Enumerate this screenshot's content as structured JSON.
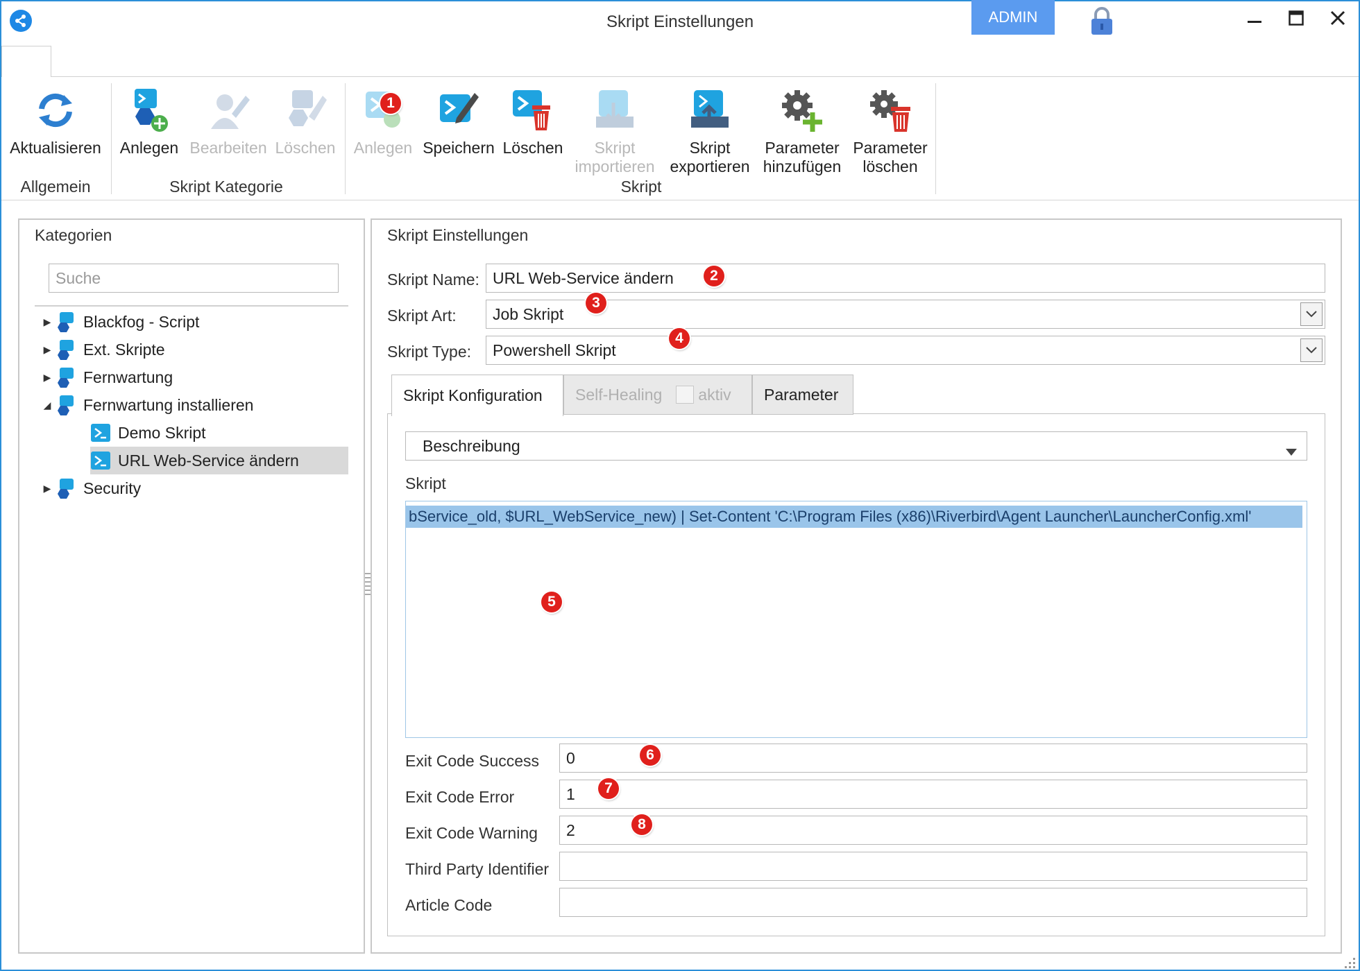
{
  "window": {
    "title": "Skript Einstellungen",
    "admin_label": "ADMIN"
  },
  "ribbon": {
    "groups": [
      {
        "label": "Allgemein"
      },
      {
        "label": "Skript Kategorie"
      },
      {
        "label": "Skript"
      }
    ],
    "buttons": {
      "refresh": "Aktualisieren",
      "cat_create": "Anlegen",
      "cat_edit": "Bearbeiten",
      "cat_delete": "Löschen",
      "script_create": "Anlegen",
      "script_save": "Speichern",
      "script_delete": "Löschen",
      "import_l1": "Skript",
      "import_l2": "importieren",
      "export_l1": "Skript",
      "export_l2": "exportieren",
      "param_add_l1": "Parameter",
      "param_add_l2": "hinzufügen",
      "param_del_l1": "Parameter",
      "param_del_l2": "löschen"
    }
  },
  "categories": {
    "title": "Kategorien",
    "search_placeholder": "Suche",
    "items": [
      {
        "label": "Blackfog - Script"
      },
      {
        "label": "Ext. Skripte"
      },
      {
        "label": "Fernwartung"
      },
      {
        "label": "Fernwartung installieren"
      },
      {
        "label": "Demo Skript"
      },
      {
        "label": "URL Web-Service ändern"
      },
      {
        "label": "Security"
      }
    ]
  },
  "settings": {
    "title": "Skript Einstellungen",
    "name_label": "Skript Name:",
    "name_value": "URL Web-Service ändern",
    "art_label": "Skript Art:",
    "art_value": "Job Skript",
    "type_label": "Skript Type:",
    "type_value": "Powershell Skript",
    "tabs": {
      "config": "Skript Konfiguration",
      "self_healing": "Self-Healing",
      "aktiv": "aktiv",
      "parameter": "Parameter"
    },
    "beschreibung": "Beschreibung",
    "skript_label": "Skript",
    "script_text": "bService_old, $URL_WebService_new) | Set-Content 'C:\\Program Files (x86)\\Riverbird\\Agent Launcher\\LauncherConfig.xml'",
    "exit_success_label": "Exit Code Success",
    "exit_success_value": "0",
    "exit_error_label": "Exit Code Error",
    "exit_error_value": "1",
    "exit_warning_label": "Exit Code Warning",
    "exit_warning_value": "2",
    "third_party_label": "Third Party Identifier",
    "third_party_value": "",
    "article_label": "Article Code",
    "article_value": ""
  },
  "badges": [
    "1",
    "2",
    "3",
    "4",
    "5",
    "6",
    "7",
    "8"
  ],
  "colors": {
    "accent": "#1e88e5",
    "admin": "#5b9bef",
    "badge": "#e0201c",
    "selection": "#9ac5ea"
  }
}
